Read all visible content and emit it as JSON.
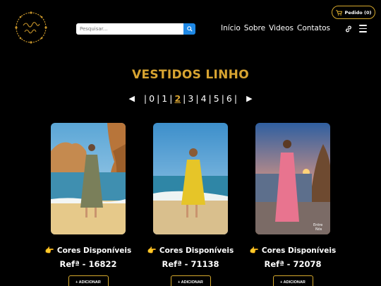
{
  "header": {
    "search_placeholder": "Pesquisar...",
    "nav": [
      "Início",
      "Sobre",
      "Videos",
      "Contatos"
    ],
    "order_label": "Pedido (0)"
  },
  "page_title": "VESTIDOS LINHO",
  "pagination": {
    "prev": "◀",
    "next": "▶",
    "pages": [
      "0",
      "1",
      "2",
      "3",
      "4",
      "5",
      "6"
    ],
    "active": "2"
  },
  "products": [
    {
      "colors_label": "Cores Disponíveis",
      "pointer": "👉",
      "ref": "Refª - 16822",
      "add_label": "+ ADICIONAR",
      "dress_color": "#7a7f5a"
    },
    {
      "colors_label": "Cores Disponíveis",
      "pointer": "👉",
      "ref": "Refª - 71138",
      "add_label": "+ ADICIONAR",
      "dress_color": "#e6c528"
    },
    {
      "colors_label": "Cores Disponíveis",
      "pointer": "👉",
      "ref": "Refª - 72078",
      "add_label": "+ ADICIONAR",
      "dress_color": "#e8748f"
    }
  ],
  "colors": {
    "accent": "#d8a431",
    "background": "#000000",
    "search_button": "#1e88e5"
  }
}
